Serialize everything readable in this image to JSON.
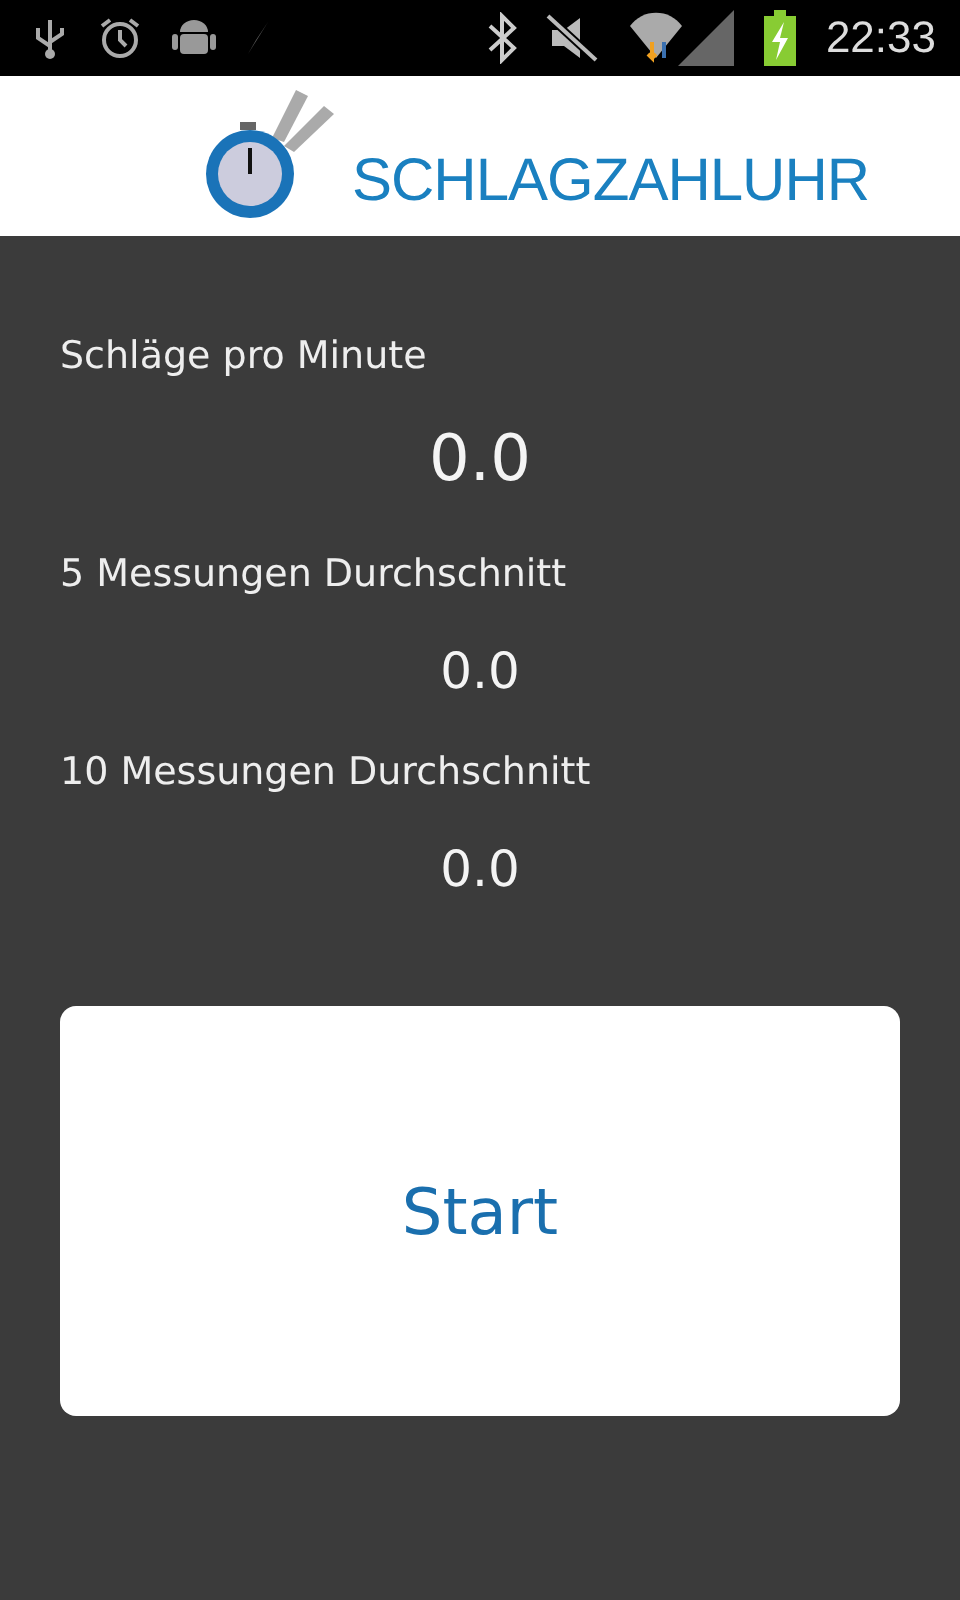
{
  "status_bar": {
    "time": "22:33"
  },
  "header": {
    "logo_text": "SCHLAGZAHLUHR"
  },
  "readings": [
    {
      "label": "Schläge pro Minute",
      "value": "0.0",
      "kind": "large"
    },
    {
      "label": "5 Messungen Durchschnitt",
      "value": "0.0",
      "kind": "small"
    },
    {
      "label": "10 Messungen Durchschnitt",
      "value": "0.0",
      "kind": "small"
    }
  ],
  "start_button": {
    "label": "Start"
  }
}
